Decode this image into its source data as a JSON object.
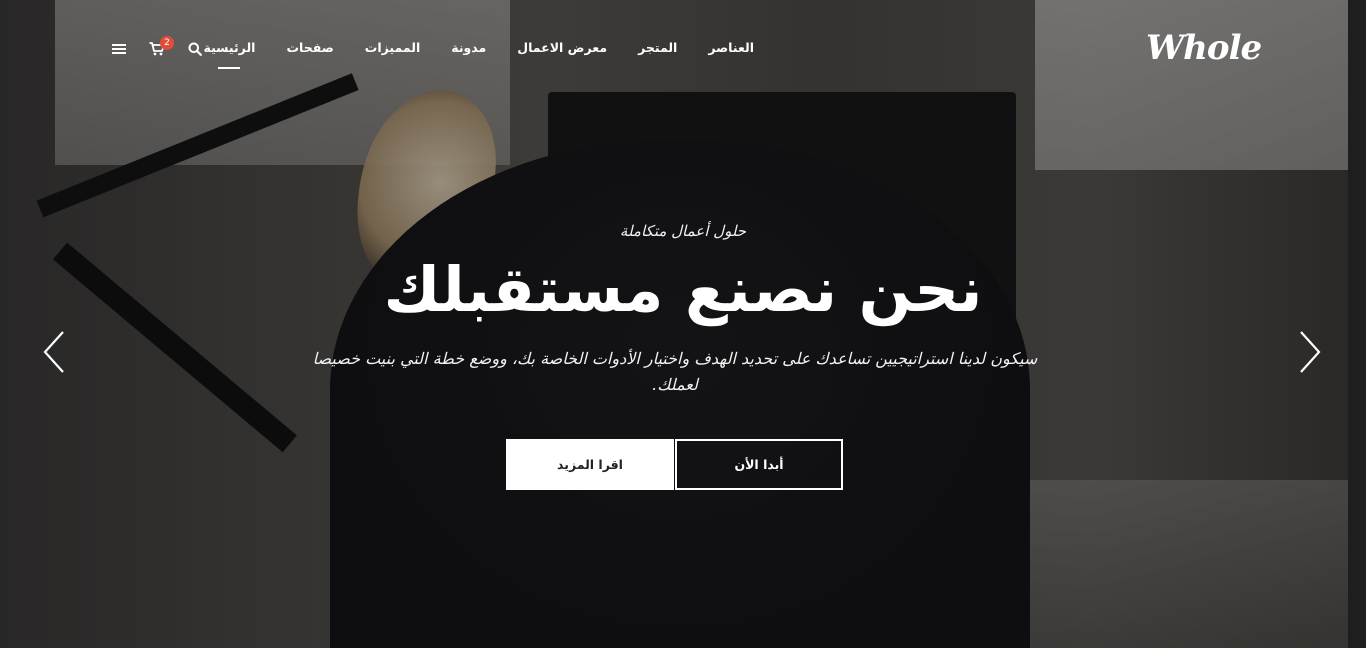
{
  "header": {
    "logo_text": "Whole",
    "nav": [
      {
        "label": "الرئيسية",
        "active": true
      },
      {
        "label": "صفحات"
      },
      {
        "label": "المميزات"
      },
      {
        "label": "مدونة"
      },
      {
        "label": "معرض الاعمال"
      },
      {
        "label": "المتجر"
      },
      {
        "label": "العناصر"
      }
    ],
    "cart_count": "2",
    "icons": {
      "search": "search-icon",
      "cart": "cart-icon",
      "menu": "hamburger-menu-icon"
    }
  },
  "hero": {
    "background_number": "54",
    "subtitle": "حلول أعمال متكاملة",
    "title": "نحن نصنع مستقبلك",
    "description": "سيكون لدينا استراتيجيين تساعدك على تحديد الهدف واختيار الأدوات الخاصة بك، ووضع خطة التي بنيت خصيصا لعملك.",
    "buttons": {
      "start": "أبدا الأن",
      "more": "اقرا المزيد"
    },
    "arrows": {
      "prev": "chevron-left-icon",
      "next": "chevron-right-icon"
    }
  },
  "colors": {
    "accent_badge": "#e04d3a",
    "text": "#ffffff",
    "button_fill": "#ffffff"
  }
}
